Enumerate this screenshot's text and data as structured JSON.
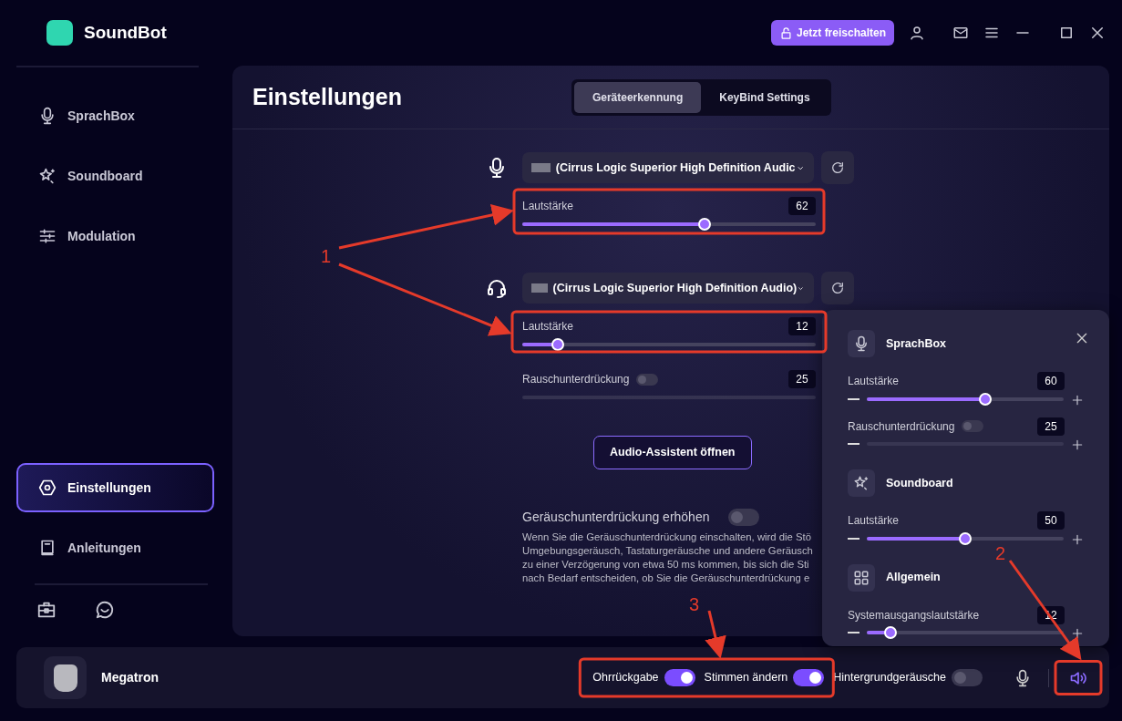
{
  "app": {
    "name": "SoundBot"
  },
  "header": {
    "unlock_button": "Jetzt freischalten"
  },
  "sidebar": {
    "items": [
      {
        "kind": "mic",
        "label": "SprachBox",
        "selected": false
      },
      {
        "kind": "sparkle",
        "label": "Soundboard",
        "selected": false
      },
      {
        "kind": "sliders",
        "label": "Modulation",
        "selected": false
      },
      {
        "kind": "gear",
        "label": "Einstellungen",
        "selected": true
      },
      {
        "kind": "book",
        "label": "Anleitungen",
        "selected": false
      }
    ]
  },
  "page": {
    "title": "Einstellungen",
    "tabs": [
      {
        "label": "Geräteerkennung",
        "selected": true
      },
      {
        "label": "KeyBind Settings",
        "selected": false
      }
    ],
    "devices": [
      {
        "kind": "mic",
        "device": "(Cirrus Logic Superior High Definition Audic",
        "volume": {
          "label": "Lautstärke",
          "value": "62",
          "level": 0.62
        }
      },
      {
        "kind": "headset",
        "device": "(Cirrus Logic Superior High Definition Audio)",
        "volume": {
          "label": "Lautstärke",
          "value": "12",
          "level": 0.12
        },
        "noise": {
          "label": "Rauschunterdrückung",
          "on": false,
          "value": "25",
          "disabled": true
        }
      }
    ],
    "assistant_button": "Audio-Assistent öffnen",
    "enhance": {
      "label": "Geräuschunterdrückung erhöhen",
      "on": false,
      "description_lines": [
        "Wenn Sie die Geräuschunterdrückung einschalten, wird die Stö",
        "Umgebungsgeräusch, Tastaturgeräusche und andere Geräusch",
        "zu einer Verzögerung von etwa 50 ms kommen, bis sich die Sti",
        "nach Bedarf entscheiden, ob Sie die Geräuschunterdrückung e"
      ]
    }
  },
  "user": {
    "name": "Megatron"
  },
  "bottom_toggles": [
    {
      "label": "Ohrrückgabe",
      "on": true
    },
    {
      "label": "Stimmen ändern",
      "on": true
    },
    {
      "label": "Hintergrundgeräusche",
      "on": false
    }
  ],
  "popover": {
    "sections": [
      {
        "kind": "mic",
        "title": "SprachBox",
        "rows": [
          {
            "label": "Lautstärke",
            "value": "60",
            "level": 0.6
          },
          {
            "label": "Rauschunterdrückung",
            "toggle_on": false,
            "value": "25",
            "disabled": true
          }
        ]
      },
      {
        "kind": "sparkle",
        "title": "Soundboard",
        "rows": [
          {
            "label": "Lautstärke",
            "value": "50",
            "level": 0.5
          }
        ]
      },
      {
        "kind": "grid",
        "title": "Allgemein",
        "rows": [
          {
            "label": "Systemausgangslautstärke",
            "value": "12",
            "level": 0.12
          }
        ]
      }
    ]
  },
  "annotations": [
    {
      "label": "1"
    },
    {
      "label": "2"
    },
    {
      "label": "3"
    }
  ]
}
